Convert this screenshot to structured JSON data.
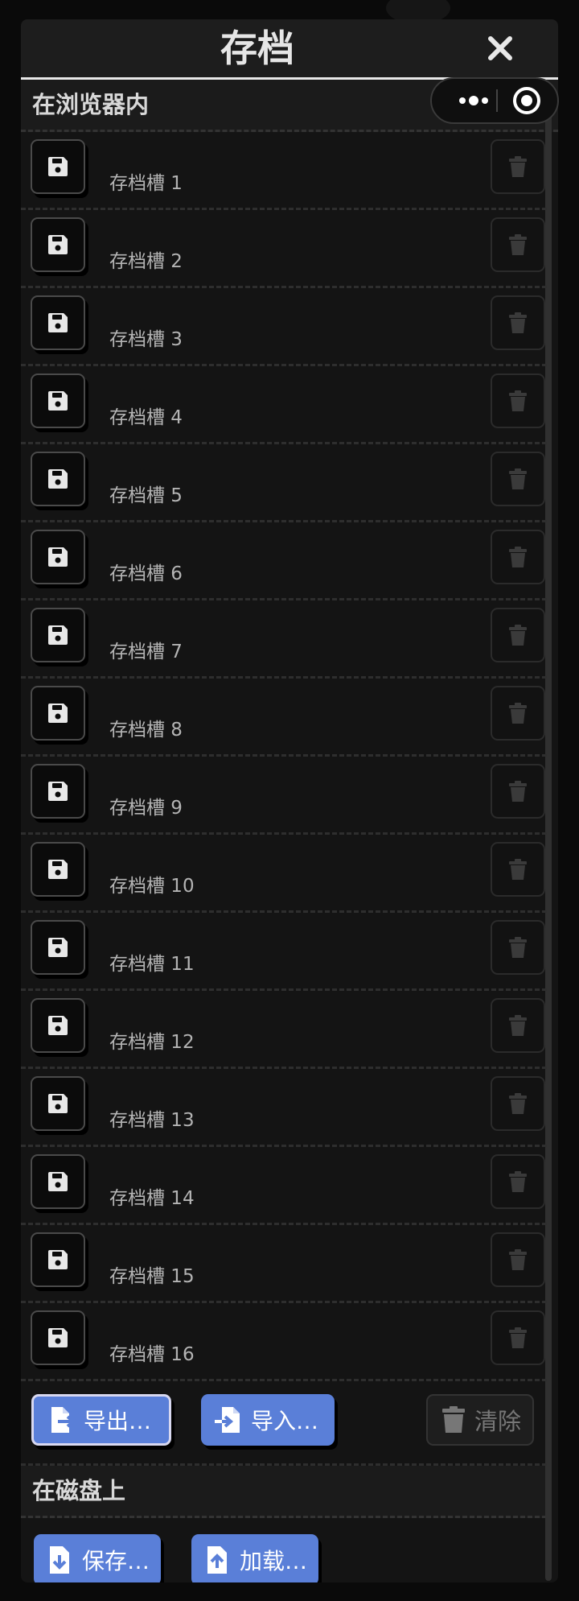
{
  "dialog": {
    "title": "存档"
  },
  "browser_section": {
    "header": "在浏览器内",
    "slots": [
      {
        "label": "存档槽 1"
      },
      {
        "label": "存档槽 2"
      },
      {
        "label": "存档槽 3"
      },
      {
        "label": "存档槽 4"
      },
      {
        "label": "存档槽 5"
      },
      {
        "label": "存档槽 6"
      },
      {
        "label": "存档槽 7"
      },
      {
        "label": "存档槽 8"
      },
      {
        "label": "存档槽 9"
      },
      {
        "label": "存档槽 10"
      },
      {
        "label": "存档槽 11"
      },
      {
        "label": "存档槽 12"
      },
      {
        "label": "存档槽 13"
      },
      {
        "label": "存档槽 14"
      },
      {
        "label": "存档槽 15"
      },
      {
        "label": "存档槽 16"
      }
    ],
    "export_label": "导出…",
    "import_label": "导入…",
    "clear_label": "清除"
  },
  "disk_section": {
    "header": "在磁盘上",
    "save_label": "保存…",
    "load_label": "加载…"
  },
  "colors": {
    "accent": "#5a7fd8",
    "panel": "#141414",
    "text": "#b4b4b4"
  },
  "icons": {
    "slot_save": "floppy-disk-icon",
    "slot_delete": "trash-icon",
    "export": "file-export-icon",
    "import": "file-import-icon",
    "clear": "trash-icon",
    "disk_save": "file-download-icon",
    "disk_load": "file-upload-icon",
    "close": "close-icon"
  }
}
